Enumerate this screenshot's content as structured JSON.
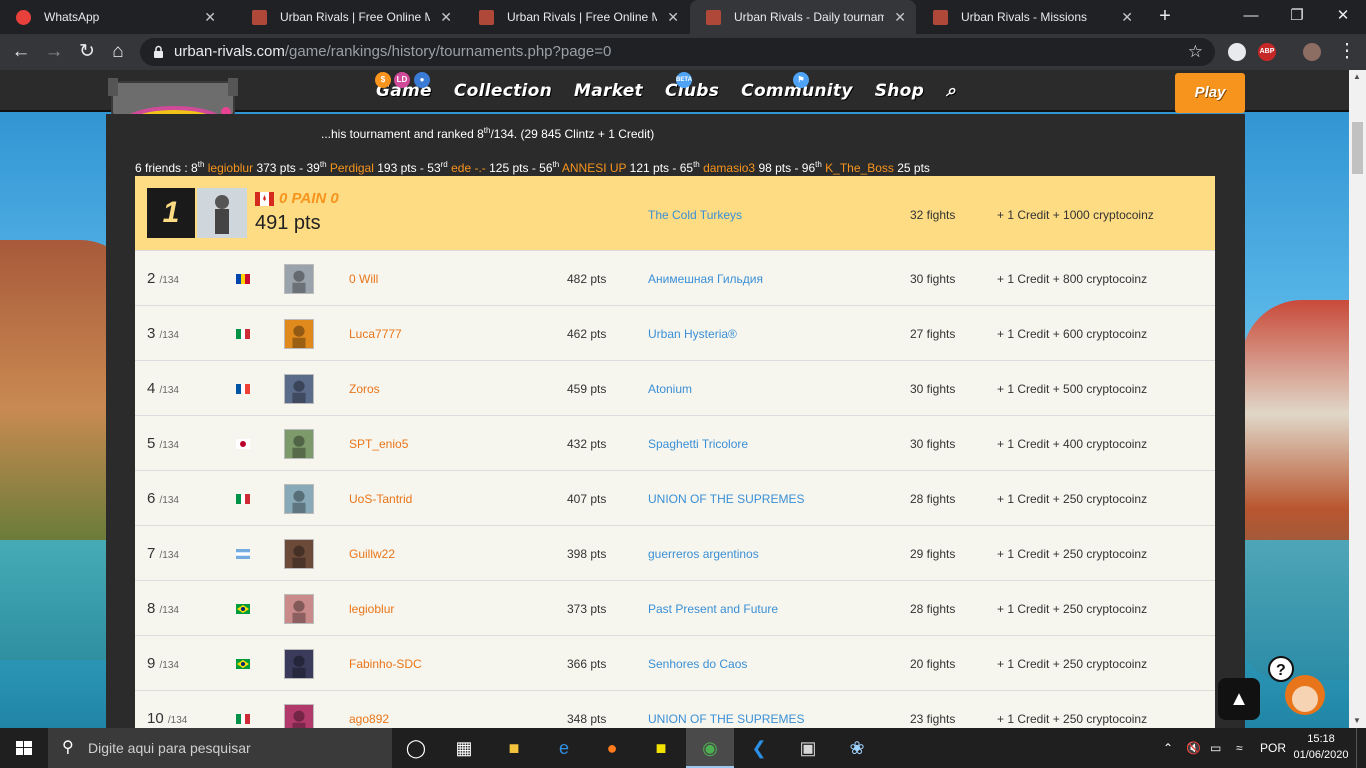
{
  "browser": {
    "tabs": [
      {
        "title": "WhatsApp",
        "active": false
      },
      {
        "title": "Urban Rivals | Free Online Man",
        "active": false
      },
      {
        "title": "Urban Rivals | Free Online Man",
        "active": false
      },
      {
        "title": "Urban Rivals - Daily tournamer",
        "active": true
      },
      {
        "title": "Urban Rivals - Missions",
        "active": false
      }
    ],
    "url_host": "urban-rivals.com",
    "url_path": "/game/rankings/history/tournaments.php?page=0"
  },
  "site": {
    "nav": [
      "Game",
      "Collection",
      "Market",
      "Clubs",
      "Community",
      "Shop"
    ],
    "play_label": "Play",
    "beta_label": "BETA"
  },
  "summary": {
    "prefix": "...his tournament and ranked 8",
    "sup": "th",
    "suffix": "/134. (29 845 Clintz + 1 Credit)"
  },
  "friends": {
    "lead": "6 friends : ",
    "items": [
      {
        "pos": "8",
        "sup": "th",
        "name": "legioblur",
        "pts": " 373 pts - "
      },
      {
        "pos": "39",
        "sup": "th",
        "name": "Perdigal",
        "pts": " 193 pts - "
      },
      {
        "pos": "53",
        "sup": "rd",
        "name": "ede -.-",
        "pts": " 125 pts - "
      },
      {
        "pos": "56",
        "sup": "th",
        "name": "ANNESI UP",
        "pts": " 121 pts - "
      },
      {
        "pos": "65",
        "sup": "th",
        "name": "damasio3",
        "pts": " 98 pts - "
      },
      {
        "pos": "96",
        "sup": "th",
        "name": "K_The_Boss",
        "pts": " 25 pts"
      }
    ]
  },
  "leader": {
    "rank": "1",
    "name": "0 PAIN 0",
    "pts": "491 pts",
    "clan": "The Cold Turkeys",
    "fights": "32 fights",
    "reward": "+ 1 Credit + 1000 cryptocoinz",
    "flag": "canada"
  },
  "rows": [
    {
      "rank": "2",
      "of": "/134",
      "flag": "moldova",
      "name": "0 Will",
      "pts": "482 pts",
      "clan": "Анимешная Гильдия",
      "fights": "30 fights",
      "reward": "+ 1 Credit + 800 cryptocoinz"
    },
    {
      "rank": "3",
      "of": "/134",
      "flag": "italy",
      "name": "Luca7777",
      "pts": "462 pts",
      "clan": "Urban Hysteria®",
      "fights": "27 fights",
      "reward": "+ 1 Credit + 600 cryptocoinz"
    },
    {
      "rank": "4",
      "of": "/134",
      "flag": "france",
      "name": "Zoros",
      "pts": "459 pts",
      "clan": "Atonium",
      "fights": "30 fights",
      "reward": "+ 1 Credit + 500 cryptocoinz"
    },
    {
      "rank": "5",
      "of": "/134",
      "flag": "japan",
      "name": "SPT_enio5",
      "pts": "432 pts",
      "clan": "Spaghetti Tricolore",
      "fights": "30 fights",
      "reward": "+ 1 Credit + 400 cryptocoinz"
    },
    {
      "rank": "6",
      "of": "/134",
      "flag": "italy",
      "name": "UoS-Tantrid",
      "pts": "407 pts",
      "clan": "UNION OF THE SUPREMES",
      "fights": "28 fights",
      "reward": "+ 1 Credit + 250 cryptocoinz"
    },
    {
      "rank": "7",
      "of": "/134",
      "flag": "argentina",
      "name": "Guillw22",
      "pts": "398 pts",
      "clan": "guerreros argentinos",
      "fights": "29 fights",
      "reward": "+ 1 Credit + 250 cryptocoinz"
    },
    {
      "rank": "8",
      "of": "/134",
      "flag": "brazil",
      "name": "legioblur",
      "pts": "373 pts",
      "clan": "Past Present and Future",
      "fights": "28 fights",
      "reward": "+ 1 Credit + 250 cryptocoinz"
    },
    {
      "rank": "9",
      "of": "/134",
      "flag": "brazil",
      "name": "Fabinho-SDC",
      "pts": "366 pts",
      "clan": "Senhores do Caos",
      "fights": "20 fights",
      "reward": "+ 1 Credit + 250 cryptocoinz"
    },
    {
      "rank": "10",
      "of": "/134",
      "flag": "italy",
      "name": "ago892",
      "pts": "348 pts",
      "clan": "UNION OF THE SUPREMES",
      "fights": "23 fights",
      "reward": "+ 1 Credit + 250 cryptocoinz"
    }
  ],
  "taskbar": {
    "search_placeholder": "Digite aqui para pesquisar",
    "lang": "POR",
    "time": "15:18",
    "date": "01/06/2020"
  },
  "colors": {
    "accent_orange": "#f7941d",
    "link_blue": "#3a8fd6",
    "leader_bg": "#fddc84"
  }
}
